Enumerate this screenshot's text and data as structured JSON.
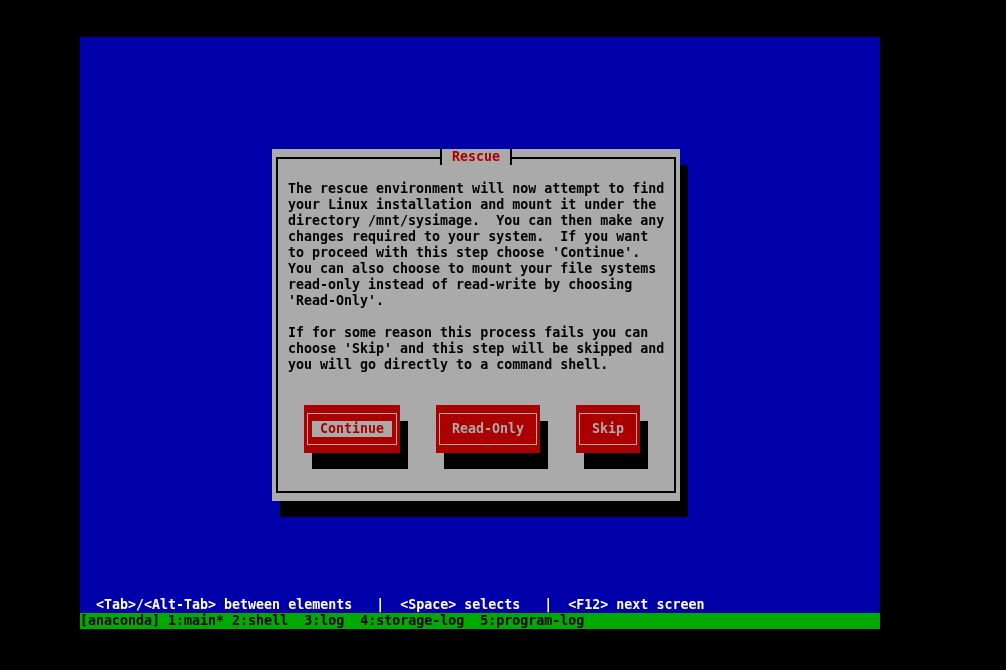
{
  "dialog": {
    "title": "Rescue",
    "paragraphs": [
      "The rescue environment will now attempt to find your Linux installation and mount it under the directory /mnt/sysimage.  You can then make any changes required to your system.  If you want to proceed with this step choose 'Continue'.  You can also choose to mount your file systems read-only instead of read-write by choosing 'Read-Only'.",
      "If for some reason this process fails you can choose 'Skip' and this step will be skipped and you will go directly to a command shell."
    ],
    "buttons": [
      {
        "label": "Continue",
        "focused": true
      },
      {
        "label": "Read-Only",
        "focused": false
      },
      {
        "label": "Skip",
        "focused": false
      }
    ]
  },
  "help_line": "<Tab>/<Alt-Tab> between elements   |  <Space> selects   |  <F12> next screen",
  "status_bar": "[anaconda] 1:main* 2:shell  3:log  4:storage-log  5:program-log"
}
